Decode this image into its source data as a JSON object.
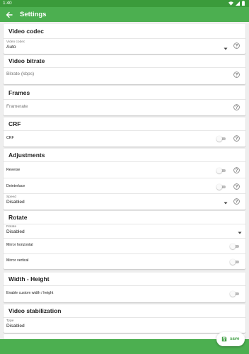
{
  "status_bar": {
    "time": "1:40"
  },
  "app_bar": {
    "title": "Settings"
  },
  "video_codec": {
    "title": "Video codec",
    "field_label": "Video codec",
    "value": "Auto"
  },
  "video_bitrate": {
    "title": "Video bitrate",
    "placeholder": "Bitrate (kbps)"
  },
  "frames": {
    "title": "Frames",
    "placeholder": "Framerate"
  },
  "crf": {
    "title": "CRF",
    "toggle_label": "CRF",
    "enabled": false
  },
  "adjustments": {
    "title": "Adjustments",
    "reverse_label": "Reverse",
    "reverse_enabled": false,
    "deinterlace_label": "Deinterlace",
    "deinterlace_enabled": false,
    "speed_label": "Speed",
    "speed_value": "Disabled"
  },
  "rotate": {
    "title": "Rotate",
    "field_label": "Rotate",
    "value": "Disabled",
    "mirror_horizontal_label": "Mirror horizontal",
    "mirror_horizontal_enabled": false,
    "mirror_vertical_label": "Mirror vertical",
    "mirror_vertical_enabled": false
  },
  "width_height": {
    "title": "Width - Height",
    "toggle_label": "Enable custom width / height",
    "enabled": false
  },
  "video_stabilization": {
    "title": "Video stabilization",
    "field_label": "Type",
    "value": "Disabled"
  },
  "fab": {
    "label": "save",
    "icon": "save-icon"
  },
  "colors": {
    "primary": "#4caf50",
    "status_bar": "#3b9b3b",
    "background": "#eeeeee",
    "card": "#ffffff"
  }
}
